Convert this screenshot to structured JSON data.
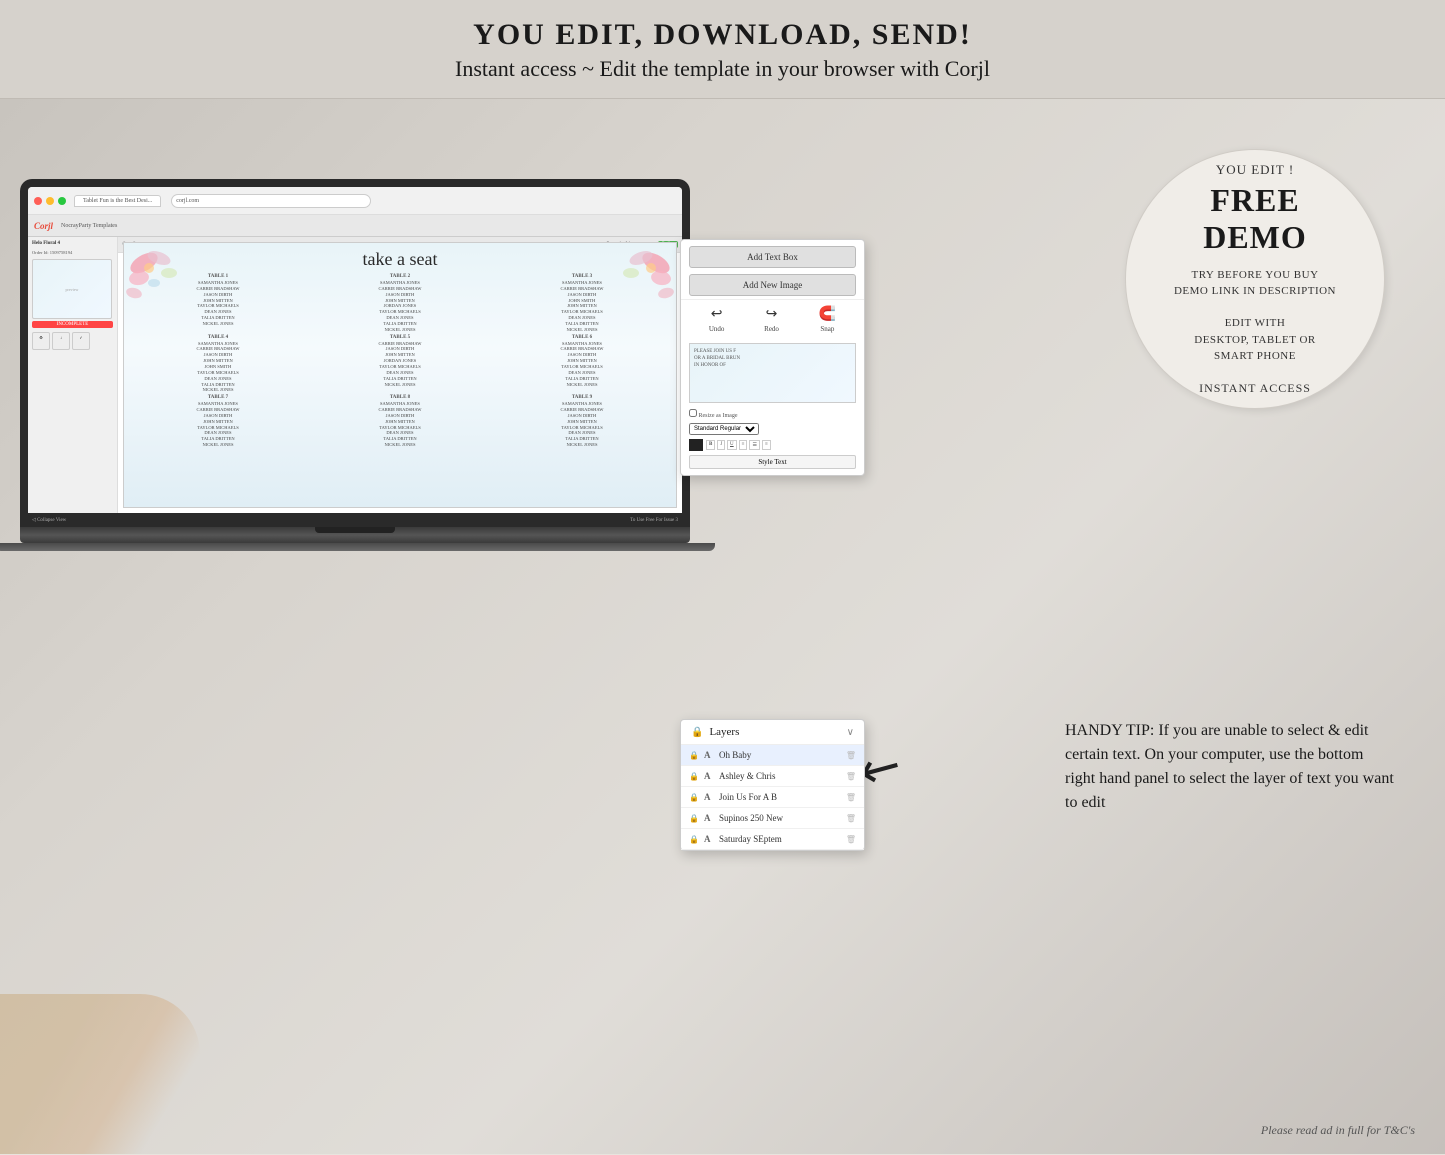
{
  "header": {
    "line1": "YOU EDIT, DOWNLOAD, SEND!",
    "line2": "Instant access ~ Edit the template in your browser with Corjl"
  },
  "browser": {
    "tab_label": "Tablet Fun is the Best Desi...",
    "address": "corjl.com",
    "corjl_logo": "Corjl"
  },
  "corjl_ui": {
    "order_label": "Order Id: 1509758194",
    "incomplete_label": "INCOMPLETE",
    "order_item": "Helo Floral 4"
  },
  "seating_chart": {
    "title": "take a seat",
    "tables": [
      {
        "label": "TABLE 1",
        "names": [
          "SAMANTHA JONES",
          "CARRIE BRADSHAW",
          "JASON DIRTH",
          "JOHN MITTEN",
          "TAYLOR MICHAELS",
          "DEAN JONES",
          "TALIA DRITTEN",
          "NICKEL JONES"
        ]
      },
      {
        "label": "TABLE 2",
        "names": [
          "SAMANTHA JONES",
          "CARRIE BRADSHAW",
          "JASON DIRTH",
          "JOHN MITTEN",
          "JORDAN JONES",
          "TAYLOR MICHAELS",
          "DEAN JONES",
          "TALIA DRITTEN",
          "NICKEL JONES"
        ]
      },
      {
        "label": "TABLE 3",
        "names": [
          "SAMANTHA JONES",
          "CARRIE BRADSHAW",
          "JASON DIRTH",
          "JOHN SMITH",
          "JOHN MITTEN",
          "TAYLOR MICHAELS",
          "DEAN JONES",
          "TALIA DRITTEN",
          "NICKEL JONES"
        ]
      },
      {
        "label": "TABLE 4",
        "names": [
          "SAMANTHA JONES",
          "CARRIE BRADSHAW",
          "JASON DIRTH",
          "JOHN MITTEN",
          "JOHN SMITH",
          "TAYLOR MICHAELS",
          "DEAN JONES",
          "TALIA DRITTEN",
          "NICKEL JONES"
        ]
      },
      {
        "label": "TABLE 5",
        "names": [
          "CARRIE BRADSHAW",
          "JASON DIRTH",
          "JOHN MITTEN",
          "JORDAN JONES",
          "TAYLOR MICHAELS",
          "DEAN JONES",
          "TALIA DRITTEN",
          "NICKEL JONES"
        ]
      },
      {
        "label": "TABLE 6",
        "names": [
          "SAMANTHA JONES",
          "CARRIE BRADSHAW",
          "JASON DIRTH",
          "JOHN MITTEN",
          "TAYLOR MICHAELS",
          "DEAN JONES",
          "TALIA DRITTEN",
          "NICKEL JONES"
        ]
      },
      {
        "label": "TABLE 7",
        "names": [
          "SAMANTHA JONES",
          "CARRIE BRADSHAW",
          "JASON DIRTH",
          "JOHN MITTEN",
          "TAYLOR MICHAELS",
          "DEAN JONES",
          "TALIA DRITTEN",
          "NICKEL JONES"
        ]
      },
      {
        "label": "TABLE 8",
        "names": [
          "SAMANTHA JONES",
          "CARRIE BRADSHAW",
          "JASON DIRTH",
          "JOHN MITTEN",
          "TAYLOR MICHAELS",
          "DEAN JONES",
          "TALIA DRITTEN",
          "NICKEL JONES"
        ]
      },
      {
        "label": "TABLE 9",
        "names": [
          "SAMANTHA JONES",
          "CARRIE BRADSHAW",
          "JASON DIRTH",
          "JOHN MITTEN",
          "TAYLOR MICHAELS",
          "DEAN JONES",
          "TALIA DRITTEN",
          "NICKEL JONES"
        ]
      }
    ]
  },
  "right_panel": {
    "add_text_box": "Add Text Box",
    "add_new_image": "Add New Image",
    "undo_label": "Undo",
    "redo_label": "Redo",
    "snap_label": "Snap",
    "preview_text": "PLEASE JOIN US F\nOR A BRIDAL BRUN\nIN HONOR OF",
    "resize_as_image": "Resize as Image",
    "standard_regular": "Standard Regular",
    "style_text": "Style Text"
  },
  "layers_panel": {
    "title": "Layers",
    "items": [
      {
        "name": "Oh Baby",
        "type": "A",
        "locked": true
      },
      {
        "name": "Ashley & Chris",
        "type": "A",
        "locked": true
      },
      {
        "name": "Join Us For A B",
        "type": "A",
        "locked": true
      },
      {
        "name": "Supinos 250 New",
        "type": "A",
        "locked": true
      },
      {
        "name": "Saturday SEptem",
        "type": "A",
        "locked": true
      }
    ]
  },
  "free_demo": {
    "you_edit": "YOU EDIT !",
    "free": "FREE",
    "demo": "DEMO",
    "try_before": "TRY BEFORE YOU BUY",
    "demo_link": "DEMO LINK IN DESCRIPTION",
    "edit_with": "EDIT WITH\nDESKTOP, TABLET OR\nSMART PHONE",
    "instant_access": "INSTANT ACCESS"
  },
  "handy_tip": {
    "label": "HANDY TIP: If you are unable to select & edit certain text. On your computer, use the bottom right hand panel to select the layer of text you want to edit"
  },
  "footer": {
    "tc_note": "Please read ad in full for T&C's"
  }
}
